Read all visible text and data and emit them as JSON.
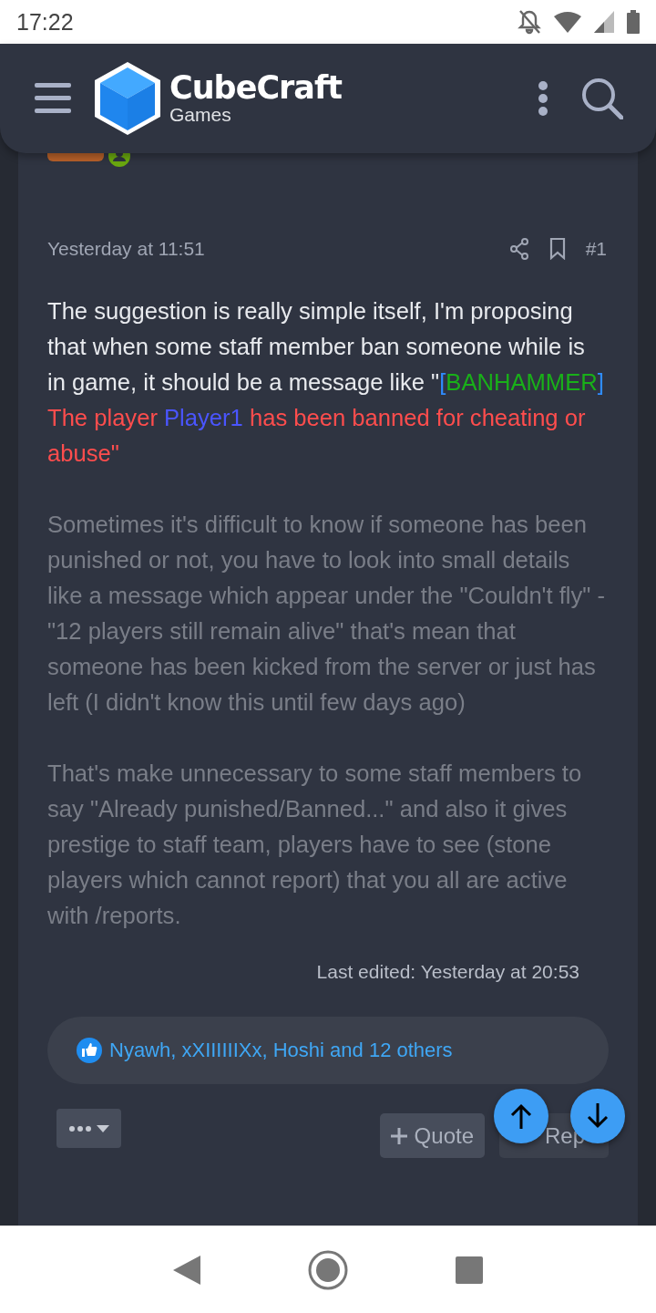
{
  "status_bar": {
    "time": "17:22"
  },
  "header": {
    "brand_name": "CubeCraft",
    "brand_sub": "Games"
  },
  "post": {
    "date": "Yesterday at 11:51",
    "post_number": "#1",
    "paragraphs": [
      {
        "dimmed": false,
        "segments": [
          {
            "text": "The suggestion is really simple itself, I'm proposing that when some staff member ban someone while is in game, it should be a message like \""
          },
          {
            "text": "[",
            "color": "#2f8cff"
          },
          {
            "text": "BANHAMMER",
            "color": "#19b019"
          },
          {
            "text": "]",
            "color": "#2f8cff"
          },
          {
            "text": " The player ",
            "color": "#ff4d4d"
          },
          {
            "text": "Player1",
            "color": "#4a55ff"
          },
          {
            "text": " has been banned for cheating or abuse\"",
            "color": "#ff4d4d"
          }
        ]
      },
      {
        "dimmed": true,
        "segments": [
          {
            "text": "Sometimes it's difficult to know if someone has been punished or not, you have to look into small details like a message which appear under the \"Couldn't fly\" - \"12 players still remain alive\" that's mean that someone has been kicked from the server or just has left (I didn't know this until few days ago)"
          }
        ]
      },
      {
        "dimmed": true,
        "segments": [
          {
            "text": "That's make unnecessary to some staff members to say \"Already punished/Banned...\" and also it gives prestige to staff team, players have to see (stone players which cannot report) that you all are active with /reports."
          }
        ]
      }
    ],
    "last_edited": "Last edited: Yesterday at 20:53",
    "reactions": "Nyawh, xXIIIIIIXx, Hoshi and 12 others",
    "quote_button": "Quote",
    "reply_button": "Rep"
  }
}
